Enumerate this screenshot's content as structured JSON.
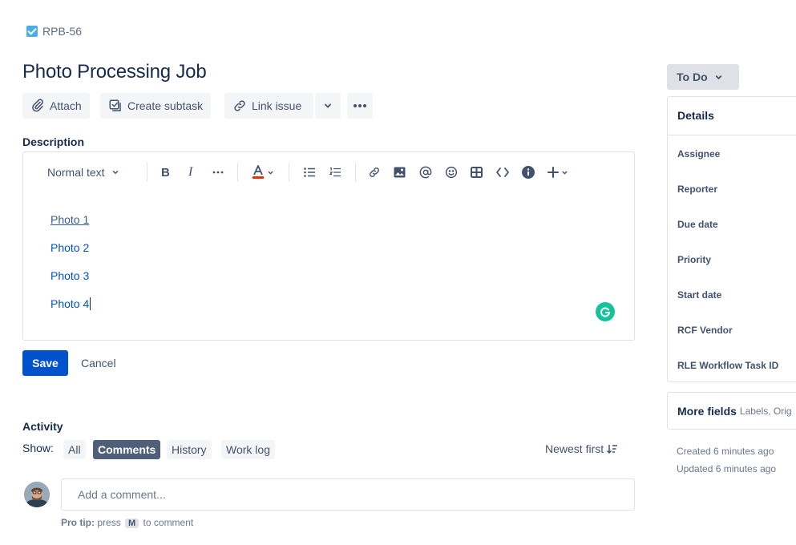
{
  "issue": {
    "key": "RPB-56",
    "title": "Photo Processing Job"
  },
  "actions": {
    "attach": "Attach",
    "create_subtask": "Create subtask",
    "link_issue": "Link issue"
  },
  "description": {
    "label": "Description",
    "text_style": "Normal text",
    "lines": [
      "Photo 1",
      "Photo 2",
      "Photo 3",
      "Photo 4"
    ],
    "save": "Save",
    "cancel": "Cancel"
  },
  "activity": {
    "title": "Activity",
    "show_label": "Show:",
    "filters": [
      "All",
      "Comments",
      "History",
      "Work log"
    ],
    "selected_filter": "Comments",
    "sort": "Newest first",
    "comment_placeholder": "Add a comment...",
    "pro_tip_label": "Pro tip:",
    "pro_tip_press": "press",
    "pro_tip_key": "M",
    "pro_tip_suffix": "to comment"
  },
  "sidebar": {
    "status": "To Do",
    "details_title": "Details",
    "fields": [
      "Assignee",
      "Reporter",
      "Due date",
      "Priority",
      "Start date",
      "RCF Vendor",
      "RLE Workflow Task ID"
    ],
    "more_fields": "More fields",
    "more_fields_sub": "Labels, Orig",
    "created": "Created 6 minutes ago",
    "updated": "Updated 6 minutes ago"
  },
  "colors": {
    "primary": "#0052cc",
    "link": "#0052cc",
    "selected_chip": "#505f79",
    "grammarly": "#15c39a"
  }
}
